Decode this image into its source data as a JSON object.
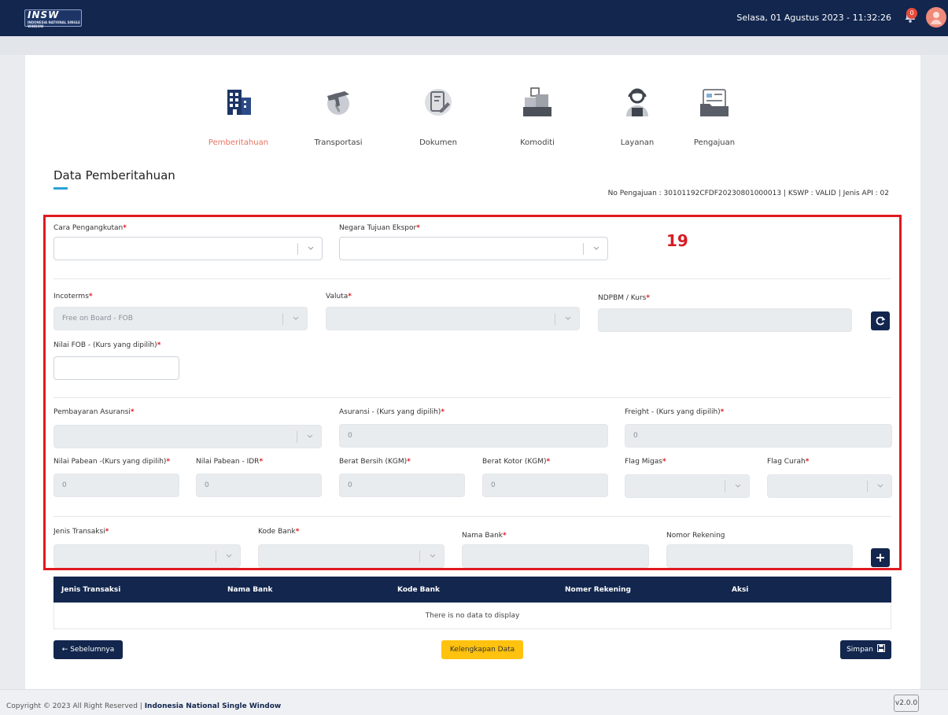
{
  "header": {
    "logo_text": "INSW",
    "logo_subtext": "INDONESIA NATIONAL SINGLE WINDOW",
    "datetime": "Selasa, 01 Agustus 2023 - 11:32:26",
    "notification_count": "0"
  },
  "steps": [
    {
      "label": "Pemberitahuan",
      "icon": "building-icon",
      "active": true
    },
    {
      "label": "Transportasi",
      "icon": "plane-globe-icon",
      "active": false
    },
    {
      "label": "Dokumen",
      "icon": "document-edit-icon",
      "active": false
    },
    {
      "label": "Komoditi",
      "icon": "boxes-icon",
      "active": false
    },
    {
      "label": "Layanan",
      "icon": "support-agent-icon",
      "active": false
    },
    {
      "label": "Pengajuan",
      "icon": "folder-icon",
      "active": false
    }
  ],
  "page": {
    "title": "Data Pemberitahuan",
    "submission_info": "No Pengajuan : 30101192CFDF20230801000013 | KSWP : VALID | Jenis API : 02",
    "annotation_number": "19"
  },
  "form": {
    "cara_pengangkutan_label": "Cara Pengangkutan",
    "negara_tujuan_label": "Negara Tujuan Ekspor",
    "incoterms_label": "Incoterms",
    "incoterms_value": "Free on Board - FOB",
    "valuta_label": "Valuta",
    "ndpbm_label": "NDPBM / Kurs",
    "nilai_fob_label": "Nilai FOB - (Kurs yang dipilih)",
    "pembayaran_asuransi_label": "Pembayaran Asuransi",
    "asuransi_label": "Asuransi - (Kurs yang dipilih)",
    "asuransi_value": "0",
    "freight_label": "Freight - (Kurs yang dipilih)",
    "freight_value": "0",
    "nilai_pabean_kurs_label": "Nilai Pabean -(Kurs yang dipilih)",
    "nilai_pabean_kurs_value": "0",
    "nilai_pabean_idr_label": "Nilai Pabean - IDR",
    "nilai_pabean_idr_value": "0",
    "berat_bersih_label": "Berat Bersih (KGM)",
    "berat_bersih_value": "0",
    "berat_kotor_label": "Berat Kotor (KGM)",
    "berat_kotor_value": "0",
    "flag_migas_label": "Flag Migas",
    "flag_curah_label": "Flag Curah",
    "jenis_transaksi_label": "Jenis Transaksi",
    "kode_bank_label": "Kode Bank",
    "nama_bank_label": "Nama Bank",
    "nomor_rekening_label": "Nomor Rekening",
    "required_mark": "*"
  },
  "table": {
    "columns": [
      "Jenis Transaksi",
      "Nama Bank",
      "Kode Bank",
      "Nomer Rekening",
      "Aksi"
    ],
    "empty_text": "There is no data to display"
  },
  "actions": {
    "back_label": "Sebelumnya",
    "completeness_label": "Kelengkapan Data",
    "save_label": "Simpan"
  },
  "footer": {
    "copyright_prefix": "Copyright © 2023 All Right Reserved | ",
    "copyright_org": "Indonesia National Single Window",
    "version": "v2.0.0"
  },
  "colors": {
    "navy": "#12264e",
    "active_step": "#e8725f",
    "annotation_red": "#e0191f",
    "yellow_button": "#ffc20e"
  }
}
